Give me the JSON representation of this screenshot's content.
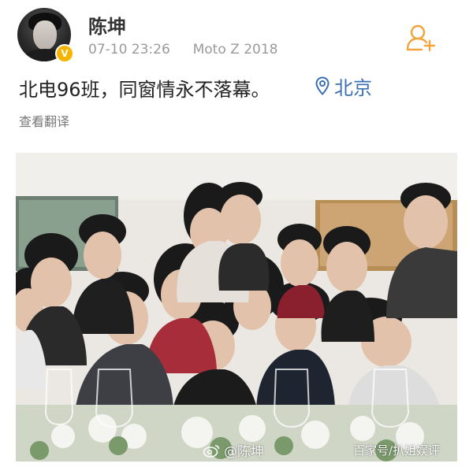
{
  "author": {
    "name": "陈坤",
    "verified_badge": "V"
  },
  "meta": {
    "timestamp": "07-10 23:26",
    "device": "Moto Z 2018"
  },
  "post": {
    "text": "北电96班，同窗情永不落幕。",
    "location": "北京",
    "translate_label": "查看翻译"
  },
  "photo": {
    "watermark_weibo": "@陈坤",
    "watermark_baijia": "百家号/扒姐娱评"
  },
  "colors": {
    "follow_accent": "#f2a33a",
    "location_blue": "#3a6fb5",
    "verified_gold": "#f5b400"
  },
  "icons": {
    "follow": "add-user-icon",
    "location": "location-pin-icon",
    "weibo": "weibo-logo-icon"
  }
}
